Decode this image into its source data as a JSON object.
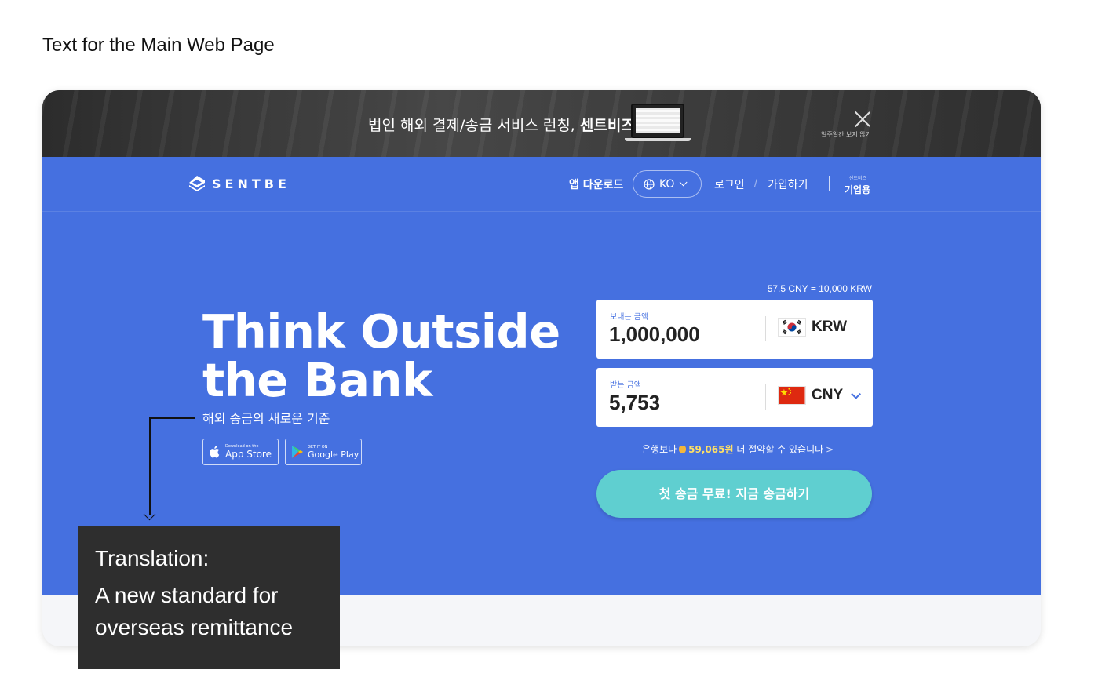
{
  "doc_title": "Text for the Main Web Page",
  "promo": {
    "text_normal": "법인 해외 결제/송금 서비스 런칭, ",
    "text_bold": "센트비즈",
    "hide_week": "일주일간 보지 않기"
  },
  "header": {
    "logo_text": "SENTBE",
    "app_download": "앱 다운로드",
    "language": "KO",
    "login": "로그인",
    "slash": "/",
    "signup": "가입하기",
    "biz_small": "센트비즈",
    "biz": "기업용"
  },
  "hero": {
    "headline_line1": "Think Outside",
    "headline_line2": "the Bank",
    "subline": "해외 송금의 새로운 기준",
    "appstore_small": "Download on the",
    "appstore_big": "App Store",
    "googleplay_small": "GET IT ON",
    "googleplay_big": "Google Play"
  },
  "calculator": {
    "rate": "57.5 CNY = 10,000 KRW",
    "send_label": "보내는 금액",
    "send_value": "1,000,000",
    "send_currency": "KRW",
    "receive_label": "받는 금액",
    "receive_value": "5,753",
    "receive_currency": "CNY",
    "savings_prefix": "은행보다",
    "savings_amount": "59,065원",
    "savings_suffix": "더 절약할 수 있습니다",
    "savings_arrow": ">",
    "cta": "첫 송금 무료! 지금 송금하기"
  },
  "annotation": {
    "title": "Translation:",
    "body": "A new standard for overseas remittance"
  },
  "colors": {
    "brand_blue": "#4570e0",
    "cta_teal": "#5fcfd0",
    "promo_dark": "#3b3b3b",
    "annotation_bg": "#2e2e2e",
    "savings_highlight": "#ffe066"
  },
  "icons": [
    "sentbe-logo-icon",
    "globe-icon",
    "chevron-down-icon",
    "close-icon",
    "apple-icon",
    "google-play-icon",
    "korea-flag-icon",
    "china-flag-icon",
    "money-bag-icon",
    "laptop-icon"
  ]
}
